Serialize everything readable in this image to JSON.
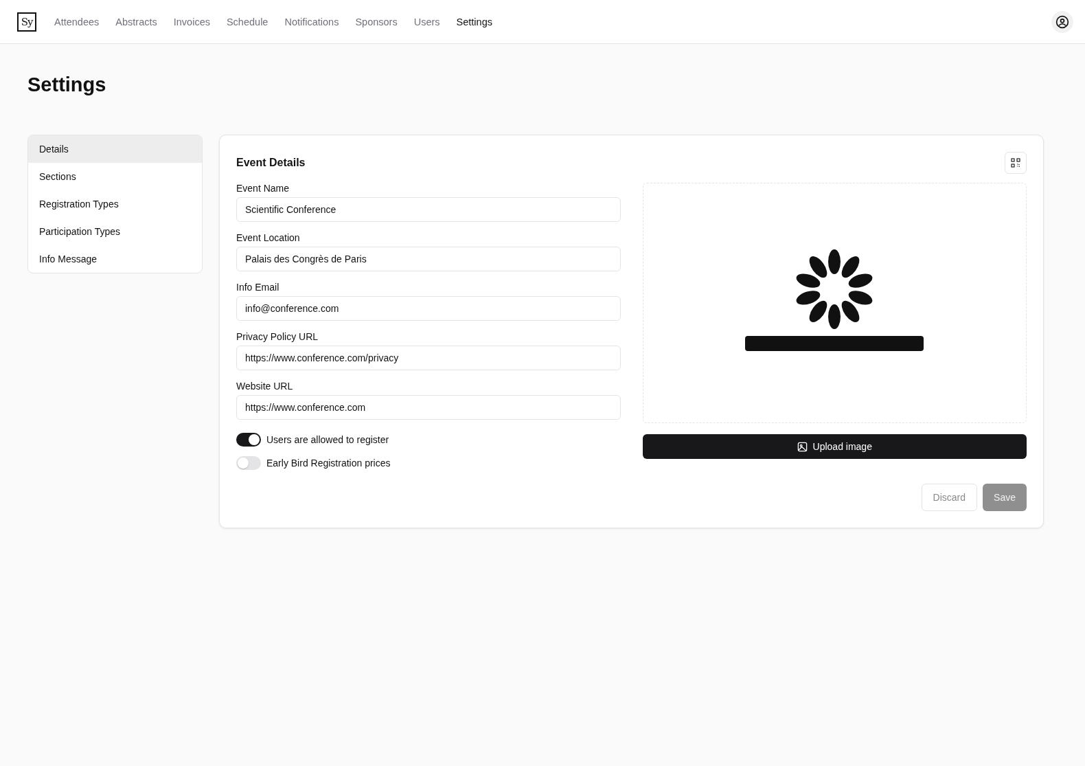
{
  "header": {
    "logo": "Sy",
    "nav": [
      {
        "label": "Attendees",
        "selected": false
      },
      {
        "label": "Abstracts",
        "selected": false
      },
      {
        "label": "Invoices",
        "selected": false
      },
      {
        "label": "Schedule",
        "selected": false
      },
      {
        "label": "Notifications",
        "selected": false
      },
      {
        "label": "Sponsors",
        "selected": false
      },
      {
        "label": "Users",
        "selected": false
      },
      {
        "label": "Settings",
        "selected": true
      }
    ]
  },
  "page_title": "Settings",
  "sidebar": {
    "items": [
      {
        "label": "Details",
        "selected": true
      },
      {
        "label": "Sections",
        "selected": false
      },
      {
        "label": "Registration Types",
        "selected": false
      },
      {
        "label": "Participation Types",
        "selected": false
      },
      {
        "label": "Info Message",
        "selected": false
      }
    ]
  },
  "card": {
    "title": "Event Details",
    "fields": [
      {
        "label": "Event Name",
        "value": "Scientific Conference"
      },
      {
        "label": "Event Location",
        "value": "Palais des Congrès de Paris"
      },
      {
        "label": "Info Email",
        "value": "info@conference.com"
      },
      {
        "label": "Privacy Policy URL",
        "value": "https://www.conference.com/privacy"
      },
      {
        "label": "Website URL",
        "value": "https://www.conference.com"
      }
    ],
    "toggles": [
      {
        "label": "Users are allowed to register",
        "on": true
      },
      {
        "label": "Early Bird Registration prices",
        "on": false
      }
    ],
    "upload_button": "Upload image",
    "buttons": [
      {
        "label": "Discard",
        "kind": "secondary",
        "disabled": true
      },
      {
        "label": "Save",
        "kind": "primary",
        "disabled": true
      }
    ]
  }
}
